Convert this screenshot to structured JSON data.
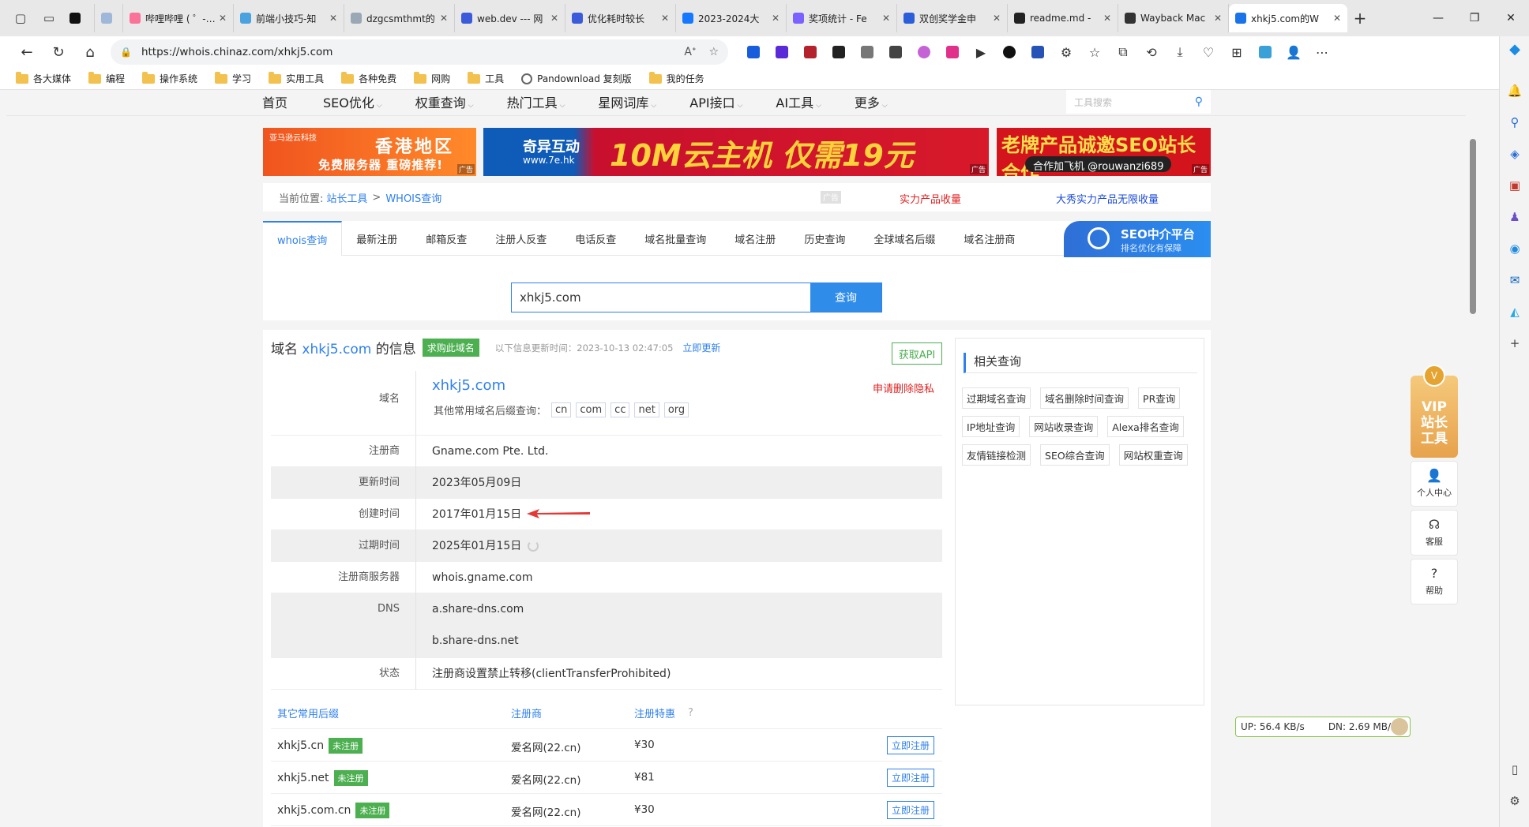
{
  "browser": {
    "tabs": [
      {
        "title": "哔哩哔哩 ( ゜- ゜",
        "color": "#fb7299"
      },
      {
        "title": "前端小技巧-知",
        "color": "#4aa3df"
      },
      {
        "title": "dzgcsmthmt的",
        "color": "#9aa7b5"
      },
      {
        "title": "web.dev --- 网",
        "color": "#3b5bdb"
      },
      {
        "title": "优化耗时较长",
        "color": "#3b5bdb"
      },
      {
        "title": "2023-2024大",
        "color": "#1677ff"
      },
      {
        "title": "奖项统计 - Fe",
        "color": "#7b61ff"
      },
      {
        "title": "双创奖学金申",
        "color": "#2b5fd9"
      },
      {
        "title": "readme.md - ",
        "color": "#222222"
      },
      {
        "title": "Wayback Mac",
        "color": "#333333"
      },
      {
        "title": "xhkj5.com的W",
        "color": "#1a73e8"
      }
    ],
    "url": "https://whois.chinaz.com/xhkj5.com",
    "bookmarks": [
      "各大媒体",
      "编程",
      "操作系统",
      "学习",
      "实用工具",
      "各种免费",
      "网购",
      "工具",
      "Pandownload 复刻版",
      "我的任务"
    ]
  },
  "nav": {
    "items": [
      {
        "label": "首页",
        "caret": ""
      },
      {
        "label": "SEO优化",
        "caret": "⌵"
      },
      {
        "label": "权重查询",
        "caret": "⌵"
      },
      {
        "label": "热门工具",
        "caret": "⌵"
      },
      {
        "label": "星网词库",
        "caret": "⌵"
      },
      {
        "label": "API接口",
        "caret": "⌵"
      },
      {
        "label": "AI工具",
        "caret": "⌵"
      },
      {
        "label": "更多",
        "caret": "⌵"
      }
    ],
    "search_placeholder": "工具搜索"
  },
  "banners": {
    "b1_small": "亚马逊云科技",
    "b1_big": "香港地区",
    "b1_sub": "免费服务器 重磅推荐!",
    "b2_logo": "奇异互动",
    "b2_logo2": "www.7e.hk",
    "b2_big": "10M云主机 仅需19元",
    "b3_big": "老牌产品诚邀SEO站长合作",
    "b3_sub": "合作加飞机 @rouwanzi689",
    "ad": "广告"
  },
  "breadcrumb": {
    "label": "当前位置:",
    "home": "站长工具",
    "sep": ">",
    "current": "WHOIS查询",
    "ad": "广告",
    "red_link": "实力产品收量",
    "blue_link": "大秀实力产品无限收量"
  },
  "tool_tabs": [
    "whois查询",
    "最新注册",
    "邮箱反查",
    "注册人反查",
    "电话反查",
    "域名批量查询",
    "域名注册",
    "历史查询",
    "全球域名后缀",
    "域名注册商"
  ],
  "seo_ad": {
    "title": "SEO中介平台",
    "sub": "排名优化有保障"
  },
  "search": {
    "value": "xhkj5.com",
    "button": "查询"
  },
  "info": {
    "title_prefix": "域名 ",
    "domain": "xhkj5.com",
    "title_suffix": " 的信息",
    "buy": "求购此域名",
    "updated": "以下信息更新时间：2023-10-13 02:47:05",
    "update_now": "立即更新",
    "api": "获取API",
    "rows": {
      "domain_label": "域名",
      "domain_value": "xhkj5.com",
      "privacy": "申请删除隐私",
      "others_label": "其他常用域名后缀查询：",
      "suffixes": [
        "cn",
        "com",
        "cc",
        "net",
        "org"
      ],
      "registrar_label": "注册商",
      "registrar": "Gname.com Pte. Ltd.",
      "updated_label": "更新时间",
      "updated": "2023年05月09日",
      "created_label": "创建时间",
      "created": "2017年01月15日",
      "expire_label": "过期时间",
      "expire": "2025年01月15日",
      "server_label": "注册商服务器",
      "server": "whois.gname.com",
      "dns_label": "DNS",
      "dns1": "a.share-dns.com",
      "dns2": "b.share-dns.net",
      "status_label": "状态",
      "status": "注册商设置禁止转移(clientTransferProhibited)"
    }
  },
  "suffix_table": {
    "headers": [
      "其它常用后缀",
      "注册商",
      "注册特惠"
    ],
    "rows": [
      {
        "domain": "xhkj5.cn",
        "tag": "未注册",
        "registrar": "爱名网(22.cn)",
        "price": "¥30",
        "action": "立即注册"
      },
      {
        "domain": "xhkj5.net",
        "tag": "未注册",
        "registrar": "爱名网(22.cn)",
        "price": "¥81",
        "action": "立即注册"
      },
      {
        "domain": "xhkj5.com.cn",
        "tag": "未注册",
        "registrar": "爱名网(22.cn)",
        "price": "¥30",
        "action": "立即注册"
      }
    ]
  },
  "related": {
    "title": "相关查询",
    "links": [
      "过期域名查询",
      "域名删除时间查询",
      "PR查询",
      "IP地址查询",
      "网站收录查询",
      "Alexa排名查询",
      "友情链接检测",
      "SEO综合查询",
      "网站权重查询"
    ]
  },
  "floating": {
    "vip_badge": "V",
    "vip": "VIP站长工具",
    "personal": "个人中心",
    "service": "客服",
    "help": "帮助"
  },
  "netspeed": {
    "up": "UP: 56.4 KB/s",
    "down": "DN: 2.69 MB/s"
  }
}
